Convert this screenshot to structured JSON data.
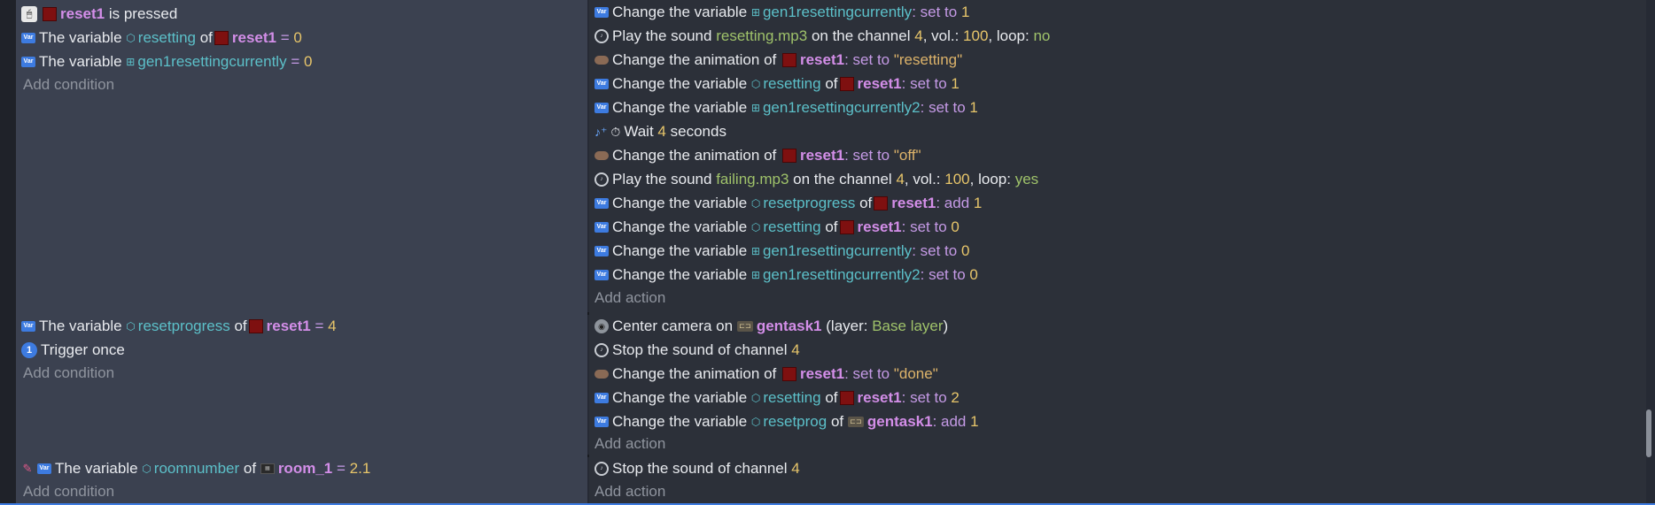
{
  "common": {
    "the_variable": "The variable",
    "change_the_variable": "Change the variable",
    "change_the_animation_of": "Change the animation of",
    "play_the_sound": "Play the sound",
    "on_the_channel": "on the channel",
    "vol": ", vol.:",
    "loop": ", loop:",
    "of": "of",
    "eq": "=",
    "set_to": ": set to",
    "add": ": add",
    "add_condition": "Add condition",
    "add_action": "Add action",
    "stop_sound": "Stop the sound of channel"
  },
  "objects": {
    "reset1": "reset1",
    "gentask1": "gentask1",
    "room_1": "room_1"
  },
  "variables": {
    "resetting": "resetting",
    "gen1resettingcurrently": "gen1resettingcurrently",
    "gen1resettingcurrently2": "gen1resettingcurrently2",
    "resetprogress": "resetprogress",
    "resetprog": "resetprog",
    "roomnumber": "roomnumber"
  },
  "events": [
    {
      "conditions": {
        "c0_suffix": "is pressed",
        "c1_value": "0",
        "c2_value": "0"
      },
      "actions": {
        "a0_value": "1",
        "a1_file": "resetting.mp3",
        "a1_channel": "4",
        "a1_vol": "100",
        "a1_loop": "no",
        "a2_anim": "\"resetting\"",
        "a3_value": "1",
        "a4_value": "1",
        "a5_wait": "Wait",
        "a5_secs": "4",
        "a5_seconds": "seconds",
        "a6_anim": "\"off\"",
        "a7_file": "failing.mp3",
        "a7_channel": "4",
        "a7_vol": "100",
        "a7_loop": "yes",
        "a8_value": "1",
        "a9_value": "0",
        "a10_value": "0",
        "a11_value": "0"
      }
    },
    {
      "conditions": {
        "c0_value": "4",
        "c1_text": "Trigger once"
      },
      "actions": {
        "a0_text": "Center camera on",
        "a0_layer_open": "(layer:",
        "a0_layer": "Base layer",
        "a0_layer_close": ")",
        "a1_channel": "4",
        "a2_anim": "\"done\"",
        "a3_value": "2",
        "a4_value": "1"
      }
    },
    {
      "conditions": {
        "c0_value": "2.1"
      },
      "actions": {
        "a0_channel": "4"
      }
    }
  ],
  "colors": {
    "conditions_bg": "#3b4150",
    "actions_bg": "#2c3039",
    "object": "#d38ee8",
    "variable": "#5cc0c9",
    "number": "#e7c56a",
    "file": "#9fc26a"
  },
  "icons": [
    "mouse-click-icon",
    "variable-icon",
    "object-thumbnail-icon",
    "global-variable-icon",
    "object-variable-icon",
    "sound-icon",
    "animation-icon",
    "wait-icon",
    "clock-icon",
    "trigger-once-icon",
    "camera-icon",
    "group-object-icon",
    "room-object-icon",
    "pin-icon"
  ]
}
